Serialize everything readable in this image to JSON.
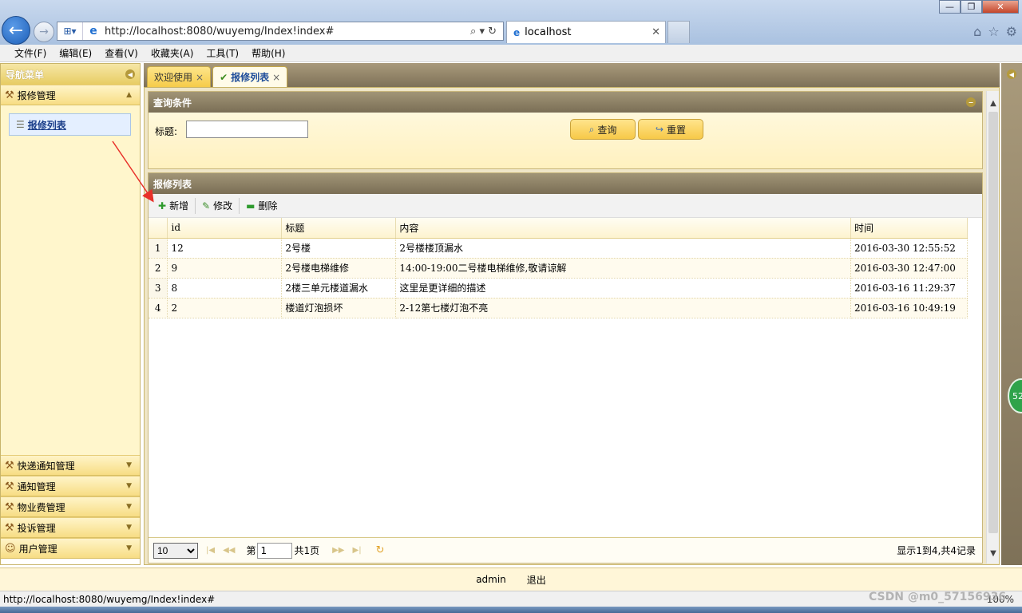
{
  "browser": {
    "url": "http://localhost:8080/wuyemg/Index!index#",
    "tab_title": "localhost",
    "menu": [
      "文件(F)",
      "编辑(E)",
      "查看(V)",
      "收藏夹(A)",
      "工具(T)",
      "帮助(H)"
    ],
    "status_url": "http://localhost:8080/wuyemg/Index!index#",
    "zoom": "100%",
    "watermark": "CSDN @m0_57156936"
  },
  "nav": {
    "title": "导航菜单",
    "open_section": "报修管理",
    "open_item": "报修列表",
    "sections": [
      "快递通知管理",
      "通知管理",
      "物业费管理",
      "投诉管理",
      "用户管理"
    ]
  },
  "tabs": [
    {
      "label": "欢迎使用"
    },
    {
      "label": "报修列表"
    }
  ],
  "query": {
    "panel_title": "查询条件",
    "title_label": "标题:",
    "title_value": "",
    "search_label": "查询",
    "reset_label": "重置"
  },
  "list": {
    "panel_title": "报修列表",
    "toolbar": {
      "add": "新增",
      "edit": "修改",
      "delete": "删除"
    },
    "columns": [
      "id",
      "标题",
      "内容",
      "时间"
    ],
    "rows": [
      {
        "n": "1",
        "id": "12",
        "title": "2号楼",
        "content": "2号楼楼顶漏水",
        "time": "2016-03-30 12:55:52"
      },
      {
        "n": "2",
        "id": "9",
        "title": "2号楼电梯维修",
        "content": "14:00-19:00二号楼电梯维修,敬请谅解",
        "time": "2016-03-30 12:47:00"
      },
      {
        "n": "3",
        "id": "8",
        "title": "2楼三单元楼道漏水",
        "content": "这里是更详细的描述",
        "time": "2016-03-16 11:29:37"
      },
      {
        "n": "4",
        "id": "2",
        "title": "楼道灯泡损坏",
        "content": "2-12第七楼灯泡不亮",
        "time": "2016-03-16 10:49:19"
      }
    ]
  },
  "pager": {
    "page_size": "10",
    "page_prefix": "第",
    "page_value": "1",
    "page_suffix": "共1页",
    "info": "显示1到4,共4记录"
  },
  "footer": {
    "user": "admin",
    "logout": "退出"
  },
  "badge": "52",
  "colors": {
    "nav_header": "#e7cc63",
    "panel_header": "#7a6e55",
    "accordion": "#f7dd84",
    "button": "#f7c948",
    "annotation_arrow": "#e8312a"
  }
}
